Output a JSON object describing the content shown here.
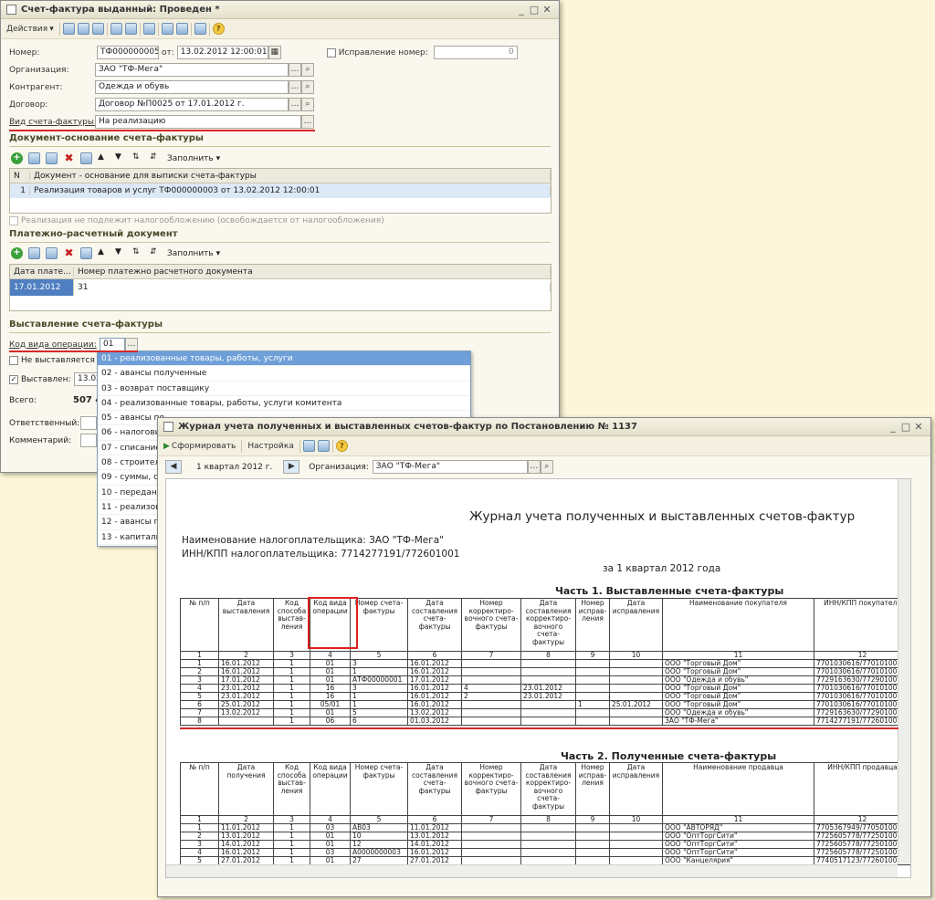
{
  "invoice_window": {
    "title": "Счет-фактура выданный: Проведен *",
    "actions_label": "Действия",
    "fields": {
      "number_label": "Номер:",
      "number_value": "ТФ000000005",
      "date_label": "от:",
      "date_value": "13.02.2012 12:00:01",
      "correction_label": "Исправление номер:",
      "correction_value": "0",
      "org_label": "Организация:",
      "org_value": "ЗАО \"ТФ-Мега\"",
      "contractor_label": "Контрагент:",
      "contractor_value": "Одежда и обувь",
      "contract_label": "Договор:",
      "contract_value": "Договор №П0025 от 17.01.2012 г.",
      "invoice_kind_label": "Вид счета-фактуры:",
      "invoice_kind_value": "На реализацию"
    },
    "basis_section": {
      "title": "Документ-основание счета-фактуры",
      "fill_label": "Заполнить",
      "col_num": "N",
      "col_doc": "Документ - основание для выписки счета-фактуры",
      "rows": [
        {
          "num": "1",
          "doc": "Реализация товаров и услуг ТФ000000003 от 13.02.2012 12:00:01"
        }
      ],
      "not_taxable_label": "Реализация не подлежит налогообложению (освобождается от налогообложения)"
    },
    "payment_section": {
      "title": "Платежно-расчетный документ",
      "fill_label": "Заполнить",
      "col_date": "Дата плате...",
      "col_number": "Номер платежно расчетного документа",
      "rows": [
        {
          "date": "17.01.2012",
          "number": "31"
        }
      ]
    },
    "issue_section": {
      "title": "Выставление счета-фактуры",
      "op_code_label": "Код вида операции:",
      "op_code_value": "01",
      "not_issued_label": "Не выставляется",
      "issued_label": "Выставлен:",
      "issued_value": "13.02",
      "total_label": "Всего:",
      "total_value": "507 4",
      "responsible_label": "Ответственный:",
      "comment_label": "Комментарий:"
    },
    "op_code_options": [
      "01 - реализованные товары, работы, услуги",
      "02 - авансы полученные",
      "03 - возврат поставщику",
      "04 - реализованные товары, работы, услуги комитента",
      "05 - авансы по",
      "06 - налоговы",
      "07 - списание",
      "08 - строитель",
      "09 - суммы, св",
      "10 - переданн",
      "11 - реализова",
      "12 - авансы по",
      "13 - капиталь"
    ]
  },
  "journal_window": {
    "title": "Журнал учета полученных и выставленных счетов-фактур по Постановлению № 1137",
    "generate_label": "Сформировать",
    "settings_label": "Настройка",
    "period_label": "1 квартал 2012 г.",
    "org_label": "Организация:",
    "org_value": "ЗАО \"ТФ-Мега\""
  },
  "report": {
    "title": "Журнал учета полученных и выставленных счетов-фактур",
    "taxpayer_line": "Наименование налогоплательщика: ЗАО \"ТФ-Мега\"",
    "inn_line": "ИНН/КПП налогоплательщика: 7714277191/772601001",
    "period_line": "за 1 квартал 2012 года",
    "part1": {
      "title": "Часть 1. Выставленные счета-фактуры",
      "headers": [
        "№ п/п",
        "Дата выставления",
        "Код способа выстав-ления",
        "Код вида операции",
        "Номер счета-фактуры",
        "Дата составления счета-фактуры",
        "Номер корректиро-вочного счета-фактуры",
        "Дата составления корректиро-вочного счета-фактуры",
        "Номер исправ-ления",
        "Дата исправления",
        "Наименование покупателя",
        "ИНН/КПП покупателя"
      ],
      "col_numbers": [
        "1",
        "2",
        "3",
        "4",
        "5",
        "6",
        "7",
        "8",
        "9",
        "10",
        "11",
        "12"
      ],
      "rows": [
        [
          "1",
          "16.01.2012",
          "1",
          "01",
          "3",
          "16.01.2012",
          "",
          "",
          "",
          "",
          "ООО \"Торговый Дом\"",
          "7701030616/770101001"
        ],
        [
          "2",
          "16.01.2012",
          "1",
          "01",
          "1",
          "16.01.2012",
          "",
          "",
          "",
          "",
          "ООО \"Торговый Дом\"",
          "7701030616/770101001"
        ],
        [
          "3",
          "17.01.2012",
          "1",
          "01",
          "АТФ00000001",
          "17.01.2012",
          "",
          "",
          "",
          "",
          "ООО \"Одежда и обувь\"",
          "7729163630/772901001"
        ],
        [
          "4",
          "23.01.2012",
          "1",
          "16",
          "3",
          "16.01.2012",
          "4",
          "23.01.2012",
          "",
          "",
          "ООО \"Торговый Дом\"",
          "7701030616/770101001"
        ],
        [
          "5",
          "23.01.2012",
          "1",
          "16",
          "1",
          "16.01.2012",
          "2",
          "23.01.2012",
          "",
          "",
          "ООО \"Торговый Дом\"",
          "7701030616/770101001"
        ],
        [
          "6",
          "25.01.2012",
          "1",
          "05/01",
          "1",
          "16.01.2012",
          "",
          "",
          "1",
          "25.01.2012",
          "ООО \"Торговый Дом\"",
          "7701030616/770101001"
        ],
        [
          "7",
          "13.02.2012",
          "1",
          "01",
          "5",
          "13.02.2012",
          "",
          "",
          "",
          "",
          "ООО \"Одежда и обувь\"",
          "7729163630/772901001"
        ],
        [
          "8",
          "",
          "1",
          "06",
          "6",
          "01.03.2012",
          "",
          "",
          "",
          "",
          "ЗАО \"ТФ-Мега\"",
          "7714277191/772601001"
        ]
      ]
    },
    "part2": {
      "title": "Часть 2. Полученные счета-фактуры",
      "headers": [
        "№ п/п",
        "Дата получения",
        "Код способа выстав-ления",
        "Код вида операции",
        "Номер счета-фактуры",
        "Дата составления счета-фактуры",
        "Номер корректиро-вочного счета-фактуры",
        "Дата составления корректиро-вочного счета-фактуры",
        "Номер исправ-ления",
        "Дата исправления",
        "Наименование продавца",
        "ИНН/КПП продавца"
      ],
      "col_numbers": [
        "1",
        "2",
        "3",
        "4",
        "5",
        "6",
        "7",
        "8",
        "9",
        "10",
        "11",
        "12"
      ],
      "rows": [
        [
          "1",
          "11.01.2012",
          "1",
          "03",
          "АВ03",
          "11.01.2012",
          "",
          "",
          "",
          "",
          "ООО \"АВТОРЯД\"",
          "7705367949/770501001"
        ],
        [
          "2",
          "13.01.2012",
          "1",
          "01",
          "10",
          "13.01.2012",
          "",
          "",
          "",
          "",
          "ООО \"ОптТоргСити\"",
          "7725605778/772501001"
        ],
        [
          "3",
          "14.01.2012",
          "1",
          "01",
          "12",
          "14.01.2012",
          "",
          "",
          "",
          "",
          "ООО \"ОптТоргСити\"",
          "7725605778/772501001"
        ],
        [
          "4",
          "16.01.2012",
          "1",
          "03",
          "А0000000003",
          "16.01.2012",
          "",
          "",
          "",
          "",
          "ООО \"ОптТоргСити\"",
          "7725605778/772501001"
        ],
        [
          "5",
          "27.01.2012",
          "1",
          "01",
          "27",
          "27.01.2012",
          "",
          "",
          "",
          "",
          "ООО \"Канцелярия\"",
          "7740517123/772601001"
        ]
      ]
    }
  }
}
